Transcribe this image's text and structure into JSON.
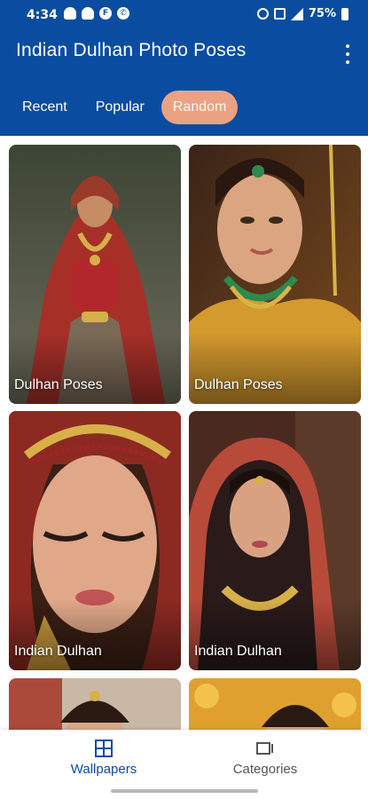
{
  "status_bar": {
    "time": "4:34",
    "battery": "75%",
    "notification_icons": [
      "snapchat-icon",
      "snapchat-icon",
      "flipboard-icon",
      "whatsapp-icon"
    ],
    "system_icons": [
      "alarm-icon",
      "data-saver-icon",
      "signal-icon",
      "battery-icon"
    ]
  },
  "header": {
    "title": "Indian Dulhan Photo Poses",
    "menu_icon": "more-vert-icon"
  },
  "tabs": [
    {
      "label": "Recent",
      "active": false
    },
    {
      "label": "Popular",
      "active": false
    },
    {
      "label": "Random",
      "active": true
    }
  ],
  "cards": [
    {
      "label": "Dulhan Poses"
    },
    {
      "label": "Dulhan Poses"
    },
    {
      "label": "Indian Dulhan"
    },
    {
      "label": "Indian Dulhan"
    },
    {
      "label": ""
    },
    {
      "label": ""
    }
  ],
  "bottom_nav": [
    {
      "label": "Wallpapers",
      "icon": "grid-icon",
      "active": true
    },
    {
      "label": "Categories",
      "icon": "categories-icon",
      "active": false
    }
  ],
  "colors": {
    "primary": "#0a4da0",
    "tab_active": "#eba283",
    "nav_inactive": "#555555"
  }
}
